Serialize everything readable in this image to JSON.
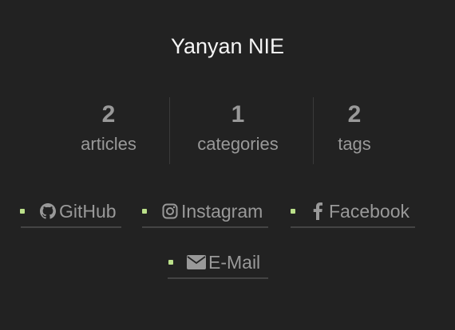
{
  "author": {
    "name": "Yanyan NIE"
  },
  "stats": [
    {
      "count": "2",
      "label": "articles"
    },
    {
      "count": "1",
      "label": "categories"
    },
    {
      "count": "2",
      "label": "tags"
    }
  ],
  "social_links": [
    {
      "label": "GitHub",
      "icon": "github-icon"
    },
    {
      "label": "Instagram",
      "icon": "instagram-icon"
    },
    {
      "label": "Facebook",
      "icon": "facebook-icon"
    },
    {
      "label": "E-Mail",
      "icon": "envelope-icon"
    }
  ],
  "colors": {
    "background": "#222222",
    "accent_bullet": "#bbe08a",
    "text_muted": "#999999",
    "text_title": "#f5f5f5"
  }
}
